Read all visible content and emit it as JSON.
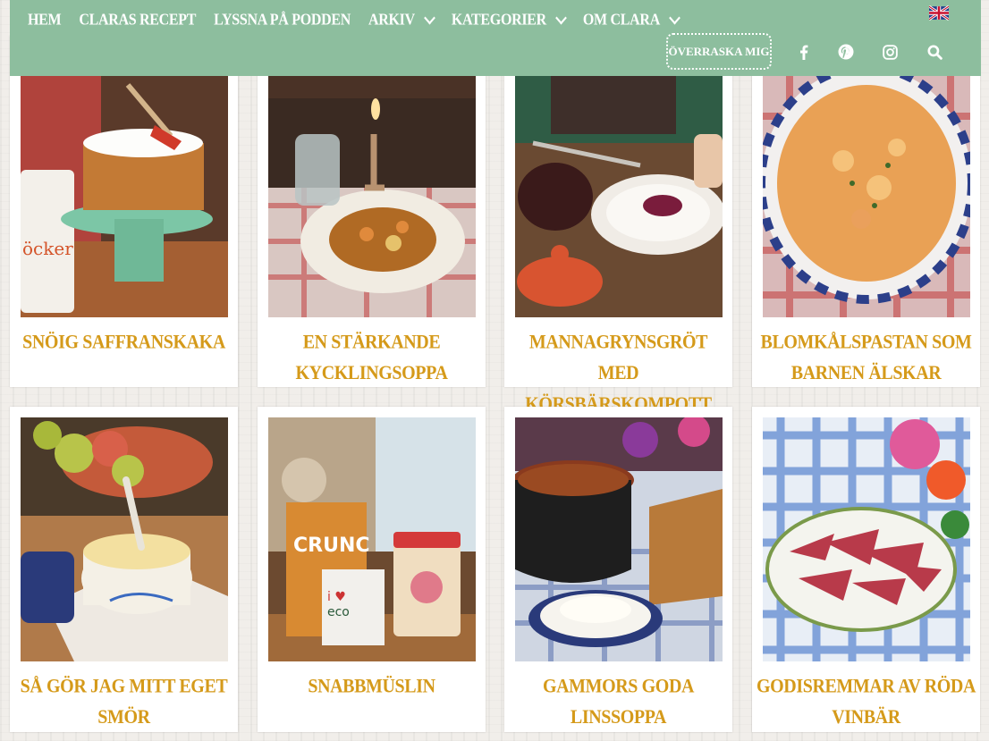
{
  "nav": {
    "items": [
      {
        "label": "HEM",
        "dropdown": false
      },
      {
        "label": "CLARAS RECEPT",
        "dropdown": false
      },
      {
        "label": "LYSSNA PÅ PODDEN",
        "dropdown": false
      },
      {
        "label": "ARKIV",
        "dropdown": true
      },
      {
        "label": "KATEGORIER",
        "dropdown": true
      },
      {
        "label": "OM CLARA",
        "dropdown": true
      }
    ],
    "surprise_label": "ÖVERRASKA MIG",
    "social": [
      "facebook-icon",
      "pinterest-icon",
      "instagram-icon",
      "search-icon"
    ],
    "language_flag": "uk-flag-icon"
  },
  "colors": {
    "header_bg": "#8dbe9e",
    "title_color": "#d59a1a"
  },
  "recipes": [
    {
      "title": "SNÖIG SAFFRANSKAKA"
    },
    {
      "title": "EN STÄRKANDE KYCKLINGSOPPA"
    },
    {
      "title": "MANNAGRYNSGRÖT MED KÖRSBÄRSKOMPOTT"
    },
    {
      "title": "BLOMKÅLSPASTAN SOM BARNEN ÄLSKAR"
    },
    {
      "title": "SÅ GÖR JAG MITT EGET SMÖR"
    },
    {
      "title": "SNABBMÜSLIN"
    },
    {
      "title": "GAMMORS GODA LINSSOPPA"
    },
    {
      "title": "GODISREMMAR AV RÖDA VINBÄR"
    }
  ]
}
